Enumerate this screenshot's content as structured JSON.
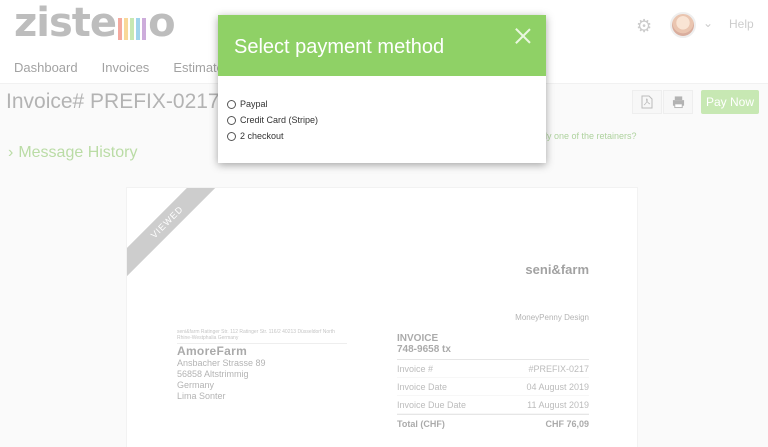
{
  "app": {
    "logo_prefix": "ziste",
    "logo_suffix": "o",
    "logo_bar_colors": [
      "#e9533f",
      "#f2b134",
      "#8fd166",
      "#3fa9d8",
      "#9b59b6"
    ]
  },
  "nav": {
    "items": [
      {
        "label": "Dashboard"
      },
      {
        "label": "Invoices"
      },
      {
        "label": "Estimates"
      }
    ]
  },
  "header": {
    "help_label": "Help",
    "icons": [
      "gear-icon",
      "avatar",
      "chevron-down-icon"
    ]
  },
  "invoice_header": {
    "title": "Invoice# PREFIX-0217",
    "pay_now_label": "Pay Now",
    "retainer_text": "ply one of the retainers?",
    "message_history_label": "Message History"
  },
  "paper": {
    "ribbon_text": "VIEWED",
    "company_name": "seni&farm",
    "designer": "MoneyPenny Design",
    "sender_line": "seni&farm Ratinger Str. 112 Ratinger Str. 116/2 40213 Düsseldorf North Rhine-Westphalia Germany",
    "client": {
      "name": "AmoreFarm",
      "lines": [
        "Ansbacher Strasse 89",
        "56858 Altstrimmig",
        "Germany",
        "Lima Sonter"
      ]
    },
    "invoice_label": "INVOICE",
    "invoice_number_display": "748-9658 tx",
    "rows": [
      {
        "label": "Invoice #",
        "value": "#PREFIX-0217"
      },
      {
        "label": "Invoice Date",
        "value": "04 August 2019"
      },
      {
        "label": "Invoice Due Date",
        "value": "11 August 2019"
      }
    ],
    "total": {
      "label": "Total (CHF)",
      "value": "CHF 76,09"
    }
  },
  "modal": {
    "title": "Select payment method",
    "options": [
      {
        "label": "Paypal"
      },
      {
        "label": "Credit Card (Stripe)"
      },
      {
        "label": "2 checkout"
      }
    ]
  },
  "colors": {
    "accent_green": "#8fd166",
    "link_green": "#74b84b"
  }
}
